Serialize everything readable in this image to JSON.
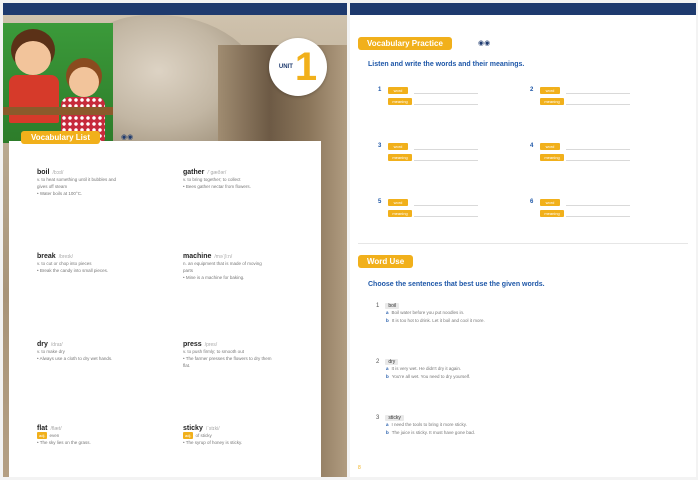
{
  "left_page": {
    "unit_badge": {
      "label": "UNIT",
      "number": "1"
    },
    "vocab_list": {
      "title": "Vocabulary List",
      "entries": [
        {
          "word": "boil",
          "pron": "/bɔɪl/",
          "lines": [
            "v. to heat something until it bubbles and",
            "gives off steam",
            "• Water boils at 100°C."
          ]
        },
        {
          "word": "gather",
          "pron": "/ˈɡæðər/",
          "lines": [
            "v. to bring together; to collect",
            "• Bees gather nectar from flowers."
          ]
        },
        {
          "word": "break",
          "pron": "/breɪk/",
          "lines": [
            "v. to cut or chop into pieces",
            "• Break the candy into small pieces."
          ]
        },
        {
          "word": "machine",
          "pron": "/məˈʃiːn/",
          "lines": [
            "n. an equipment that is made of moving",
            "parts",
            "• Mine is a machine for baking."
          ]
        },
        {
          "word": "dry",
          "pron": "/draɪ/",
          "lines": [
            "v. to make dry",
            "• Always use a cloth to dry wet hands."
          ]
        },
        {
          "word": "press",
          "pron": "/pres/",
          "lines": [
            "v. to push firmly; to smooth out",
            "• The farmer presses the flowers to dry them",
            "flat."
          ]
        },
        {
          "word": "flat",
          "pron": "/flæt/",
          "tag": "adj.",
          "lines": [
            "even",
            "• The sky lies on the grass."
          ]
        },
        {
          "word": "sticky",
          "pron": "/ˈstɪki/",
          "tag": "adj.",
          "lines": [
            "of sticky",
            "• The syrup of honey is sticky."
          ]
        }
      ]
    }
  },
  "right_page": {
    "practice": {
      "title": "Vocabulary Practice",
      "instruction": "Listen and write the words and their meanings.",
      "items": [
        {
          "num": "1",
          "word_label": "word",
          "meaning_label": "meaning"
        },
        {
          "num": "2",
          "word_label": "word",
          "meaning_label": "meaning"
        },
        {
          "num": "3",
          "word_label": "word",
          "meaning_label": "meaning"
        },
        {
          "num": "4",
          "word_label": "word",
          "meaning_label": "meaning"
        },
        {
          "num": "5",
          "word_label": "word",
          "meaning_label": "meaning"
        },
        {
          "num": "6",
          "word_label": "word",
          "meaning_label": "meaning"
        }
      ]
    },
    "word_use": {
      "title": "Word Use",
      "instruction": "Choose the sentences that best use the given words.",
      "questions": [
        {
          "num": "1",
          "word": "boil",
          "options": [
            {
              "letter": "a",
              "text": "Boil water before you put noodles in."
            },
            {
              "letter": "b",
              "text": "It is too hot to drink. Let it boil and cool it more."
            }
          ]
        },
        {
          "num": "2",
          "word": "dry",
          "options": [
            {
              "letter": "a",
              "text": "It is very wet. He didn't dry it again."
            },
            {
              "letter": "b",
              "text": "You're all wet. You need to dry yourself."
            }
          ]
        },
        {
          "num": "3",
          "word": "sticky",
          "options": [
            {
              "letter": "a",
              "text": "I need the tools to bring it more sticky."
            },
            {
              "letter": "b",
              "text": "The juice is sticky. It must have gone bad."
            }
          ]
        }
      ]
    },
    "page_number": "8"
  },
  "colors": {
    "accent": "#f1b01b",
    "navy": "#1e3a6e",
    "blue_text": "#1e57a8"
  }
}
